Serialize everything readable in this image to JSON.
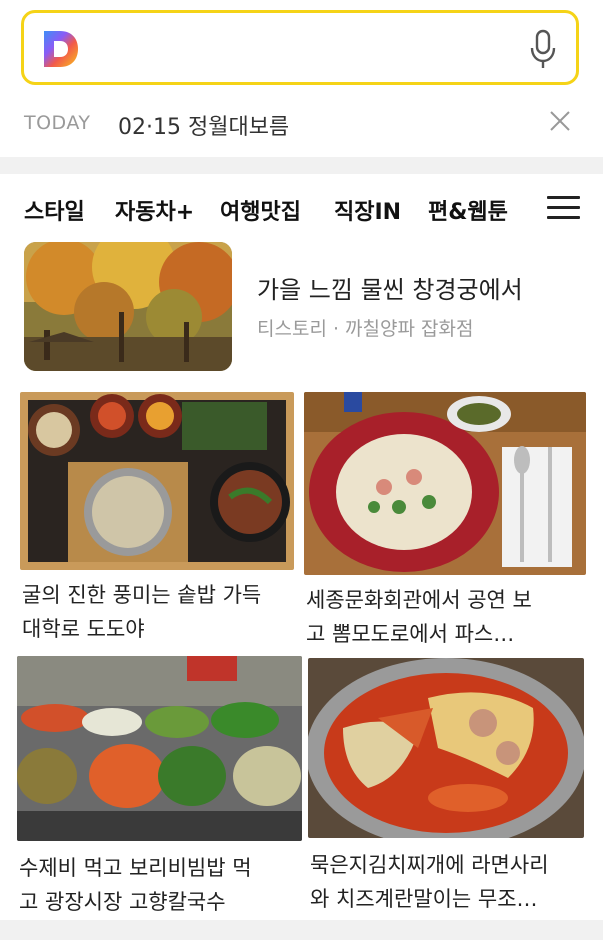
{
  "search": {
    "logo_icon": "daum-logo-icon",
    "mic_icon": "microphone-icon",
    "border_color": "#f5d317"
  },
  "today": {
    "label": "TODAY",
    "text": "02·15 정월대보름",
    "close_icon": "close-icon"
  },
  "tabs": [
    "스타일",
    "자동차+",
    "여행맛집",
    "직장IN",
    "편&웹툰"
  ],
  "menu_icon": "hamburger-menu-icon",
  "feature": {
    "title": "가을 느낌 물씬 창경궁에서",
    "source": "티스토리 · 까칠양파 잡화점"
  },
  "cards": [
    {
      "caption_line1": "굴의 진한 풍미는 솥밥 가득",
      "caption_line2": "대학로 도도야"
    },
    {
      "caption_line1": "세종문화회관에서 공연 보",
      "caption_line2": "고 뽐모도로에서 파스…"
    },
    {
      "caption_line1": "수제비 먹고 보리비빔밥 먹",
      "caption_line2": "고 광장시장 고향칼국수"
    },
    {
      "caption_line1": "묵은지김치찌개에 라면사리",
      "caption_line2": "와 치즈계란말이는 무조…"
    }
  ]
}
